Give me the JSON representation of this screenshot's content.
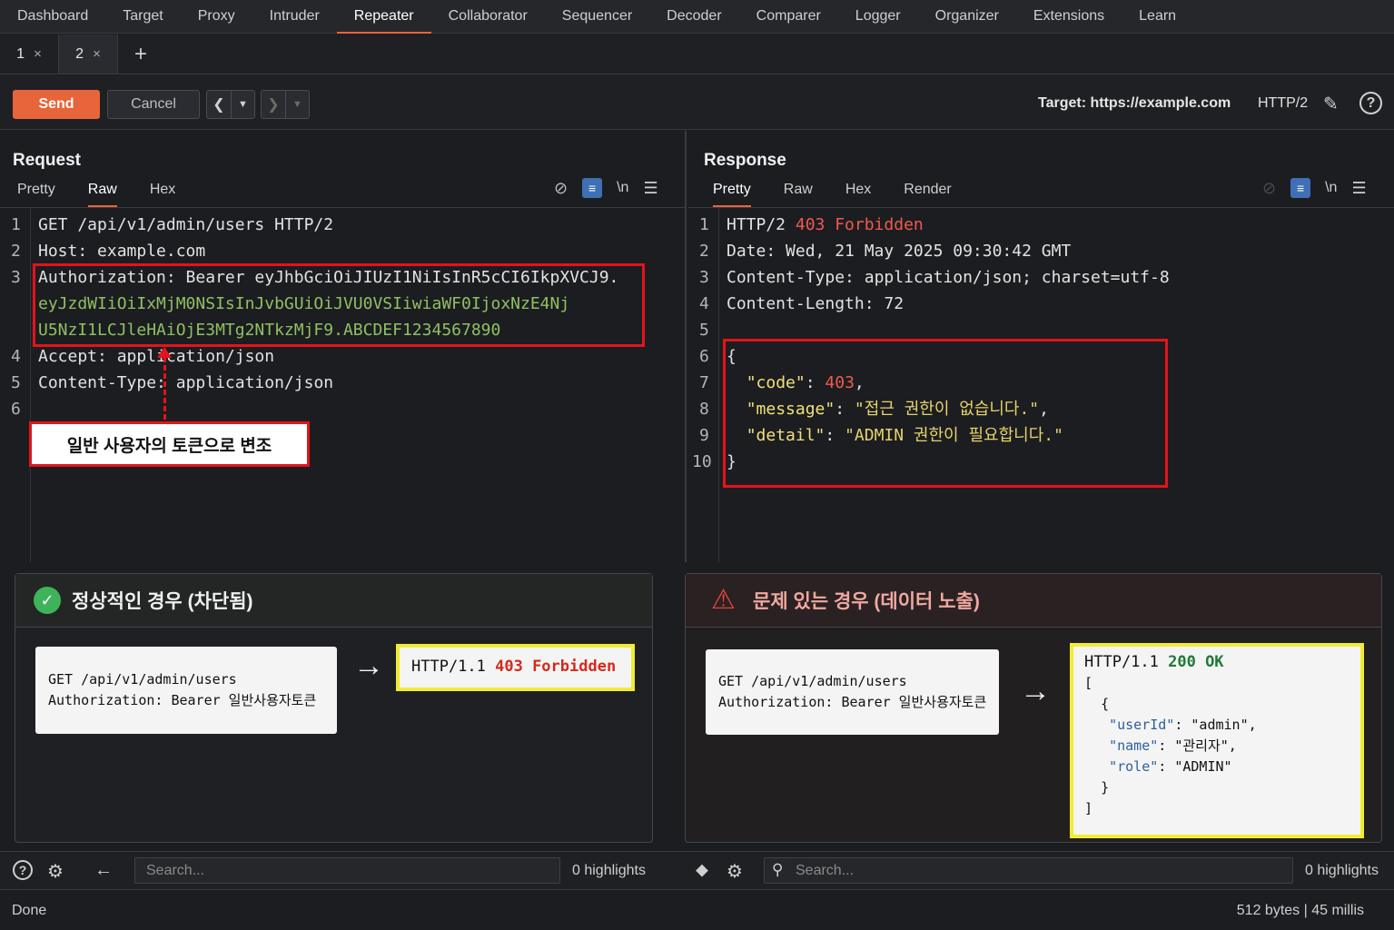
{
  "nav": [
    "Dashboard",
    "Target",
    "Proxy",
    "Intruder",
    "Repeater",
    "Collaborator",
    "Sequencer",
    "Decoder",
    "Comparer",
    "Logger",
    "Organizer",
    "Extensions",
    "Learn"
  ],
  "tabs": [
    {
      "label": "1",
      "close": "×"
    },
    {
      "label": "2",
      "close": "×"
    }
  ],
  "add_tab": "+",
  "toolbar": {
    "send": "Send",
    "cancel": "Cancel",
    "target": "Target: https://example.com",
    "http_version": "HTTP/2",
    "help": "?"
  },
  "request": {
    "title": "Request",
    "tabs": [
      "Pretty",
      "Raw",
      "Hex"
    ],
    "active_tab": "Raw",
    "nl_icon": "\\n",
    "lines": [
      {
        "n": "1",
        "text": "GET /api/v1/admin/users HTTP/2"
      },
      {
        "n": "2",
        "key": "Host:",
        "val": " example.com"
      },
      {
        "n": "3",
        "key": "Authorization:",
        "val": " Bearer eyJhbGciOiJIUzI1NiIsInR5cCI6IkpXVCJ9.",
        "cont1": "eyJzdWIiOiIxMjM0NSIsInJvbGUiOiJVU0VSIiwiaWF0IjoxNzE4Nj",
        "cont2": "U5NzI1LCJleHAiOjE3MTg2NTkzMjF9.ABCDEF1234567890"
      },
      {
        "n": "4",
        "key": "Accept:",
        "val": " application/json"
      },
      {
        "n": "5",
        "key": "Content-Type:",
        "val": " application/json"
      },
      {
        "n": "6",
        "text": ""
      }
    ],
    "annotation": "일반 사용자의 토큰으로 변조"
  },
  "response": {
    "title": "Response",
    "tabs": [
      "Pretty",
      "Raw",
      "Hex",
      "Render"
    ],
    "active_tab": "Pretty",
    "nl_icon": "\\n",
    "status_proto": "HTTP/2 ",
    "status_code": "403 Forbidden",
    "headers": [
      {
        "n": "2",
        "key": "Date:",
        "val": " Wed, 21 May 2025 09:30:42 GMT"
      },
      {
        "n": "3",
        "key": "Content-Type:",
        "val": " application/json; charset=utf-8"
      },
      {
        "n": "4",
        "key": "Content-Length:",
        "val": " 72"
      }
    ],
    "body": {
      "open": "{",
      "close": "}",
      "code_key": "\"code\"",
      "code_val": "403",
      "message_key": "\"message\"",
      "message_val": "\"접근 권한이 없습니다.\"",
      "detail_key": "\"detail\"",
      "detail_val": "\"ADMIN 권한이 필요합니다.\""
    }
  },
  "ok_case": {
    "title": "정상적인 경우 (차단됨)",
    "req_line1": "GET /api/v1/admin/users",
    "req_line2": "Authorization: Bearer 일반사용자토큰",
    "res_proto": "HTTP/1.1 ",
    "res_code": "403 Forbidden"
  },
  "bad_case": {
    "title": "문제 있는 경우 (데이터 노출)",
    "req_line1": "GET /api/v1/admin/users",
    "req_line2": "Authorization: Bearer 일반사용자토큰",
    "res_proto": "HTTP/1.1 ",
    "res_code": "200 OK",
    "json": {
      "open_bracket": "[",
      "open_brace": "{",
      "userId_key": "\"userId\"",
      "userId_val": "\"admin\",",
      "name_key": "\"name\"",
      "name_val": "\"관리자\",",
      "role_key": "\"role\"",
      "role_val": "\"ADMIN\"",
      "close_brace": "}",
      "close_bracket": "]"
    }
  },
  "search": {
    "placeholder": "Search...",
    "left_highlights": "0 highlights",
    "right_highlights": "0 highlights"
  },
  "status": {
    "left": "Done",
    "right": "512 bytes | 45 millis"
  },
  "colors": {
    "accent": "#e8643a",
    "highlight_red": "#e3141b",
    "highlight_yellow": "#f1ec32",
    "ok_green": "#3fb35a"
  }
}
